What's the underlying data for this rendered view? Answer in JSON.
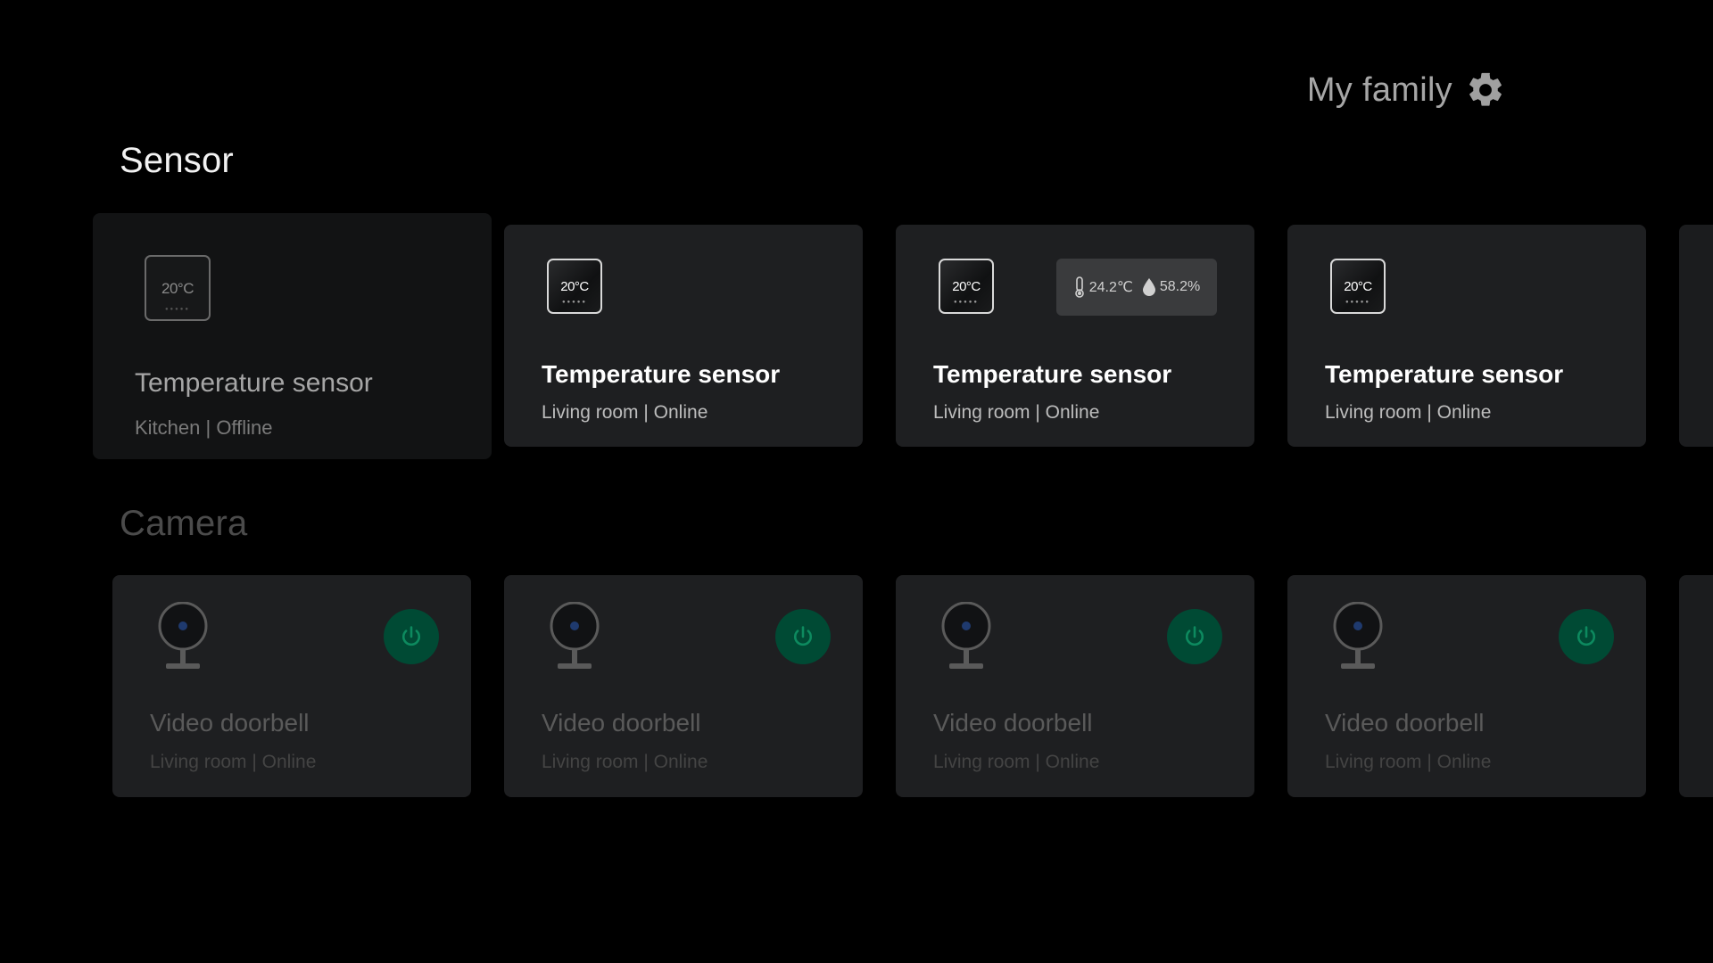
{
  "header": {
    "family_title": "My family",
    "settings_icon": "gear-icon"
  },
  "sections": {
    "sensor_title": "Sensor",
    "camera_title": "Camera"
  },
  "sensors": [
    {
      "title": "Temperature sensor",
      "subtitle": "Kitchen | Offline",
      "icon_label": "20°C",
      "focused": true
    },
    {
      "title": "Temperature sensor",
      "subtitle": "Living room | Online",
      "icon_label": "20°C"
    },
    {
      "title": "Temperature sensor",
      "subtitle": "Living room | Online",
      "icon_label": "20°C",
      "reading": {
        "temperature": "24.2℃",
        "humidity": "58.2%"
      }
    },
    {
      "title": "Temperature sensor",
      "subtitle": "Living room | Online",
      "icon_label": "20°C"
    }
  ],
  "cameras": [
    {
      "title": "Video doorbell",
      "subtitle": "Living room | Online"
    },
    {
      "title": "Video doorbell",
      "subtitle": "Living room | Online"
    },
    {
      "title": "Video doorbell",
      "subtitle": "Living room | Online"
    },
    {
      "title": "Video doorbell",
      "subtitle": "Living room | Online"
    }
  ],
  "colors": {
    "background": "#000000",
    "card": "#1e1f21",
    "power_button": "#004a34",
    "power_icon": "#0d8a5f"
  }
}
